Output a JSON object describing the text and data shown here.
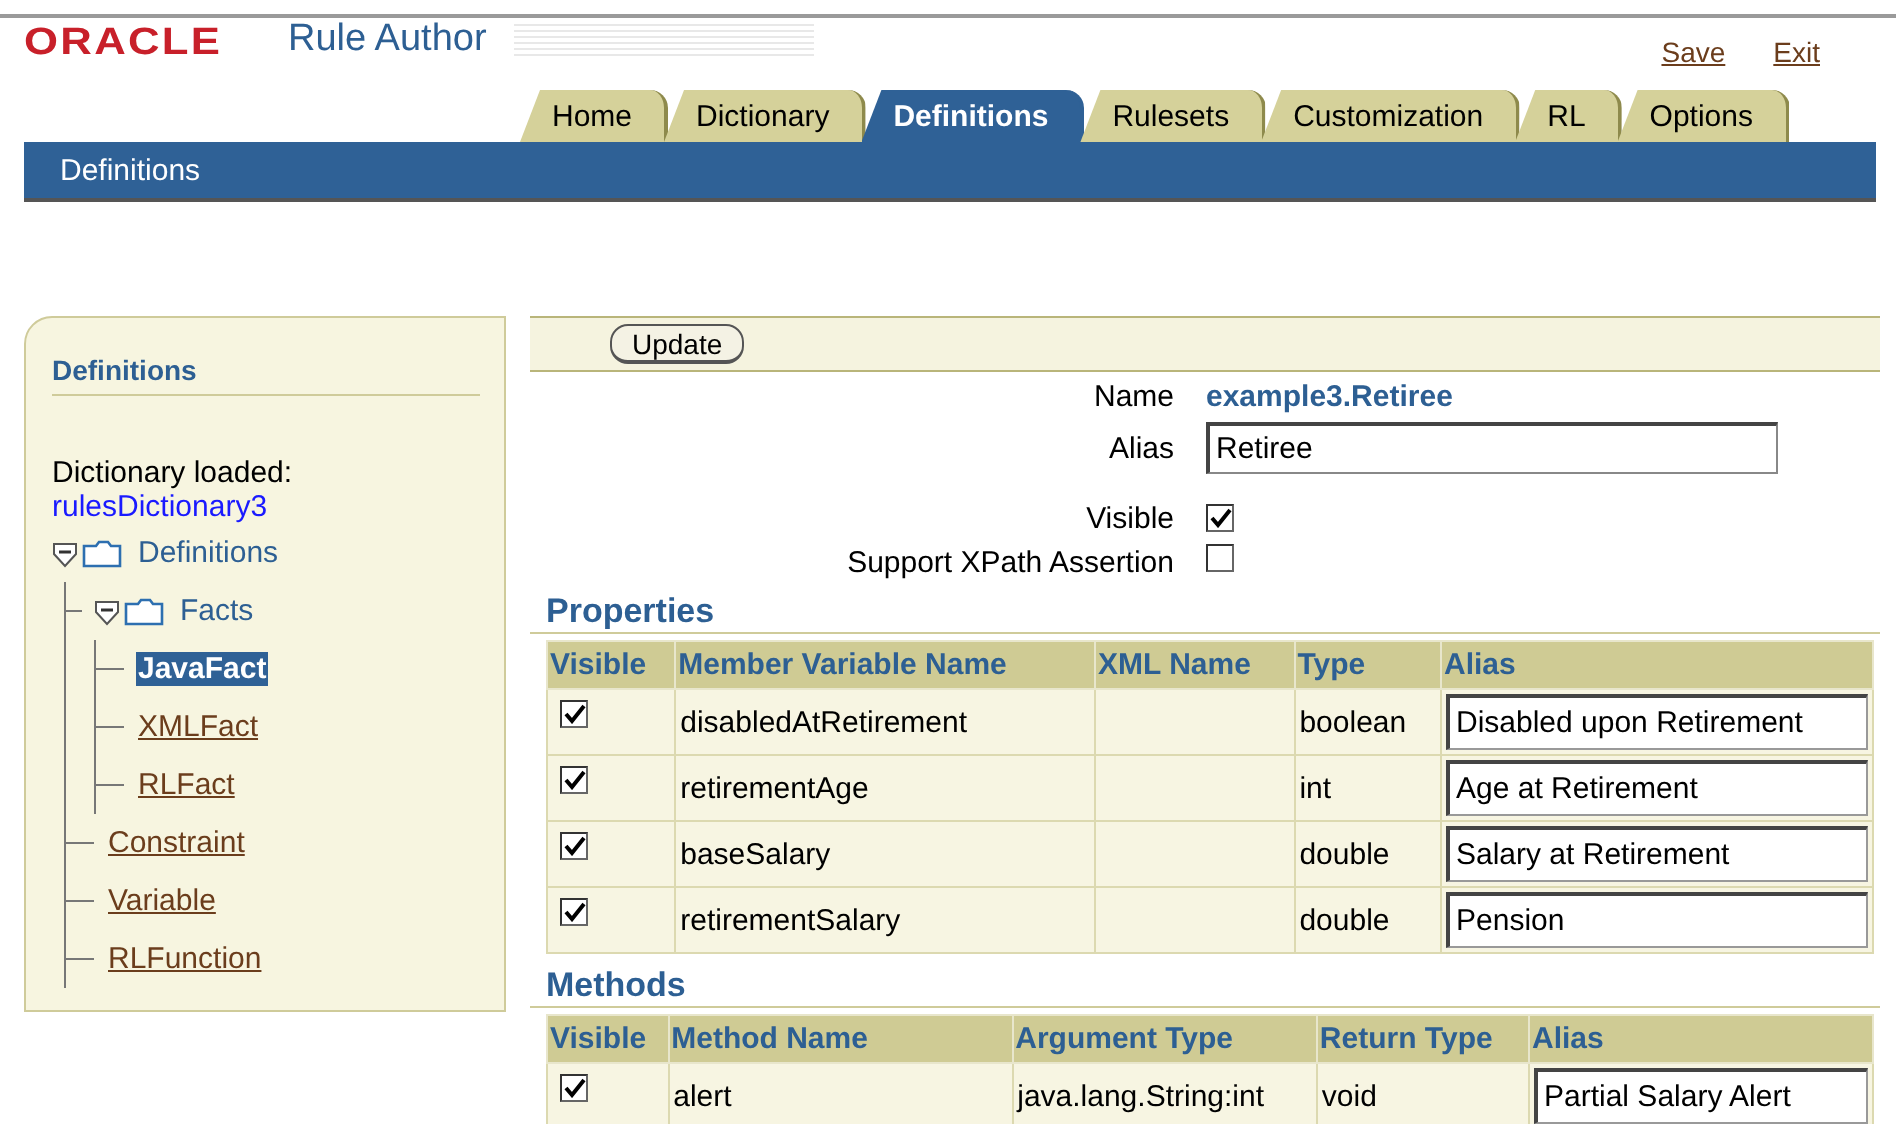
{
  "header": {
    "logo": "ORACLE",
    "app_title": "Rule Author",
    "links": [
      "Save",
      "Exit"
    ]
  },
  "tabs": [
    {
      "label": "Home",
      "selected": false
    },
    {
      "label": "Dictionary",
      "selected": false
    },
    {
      "label": "Definitions",
      "selected": true
    },
    {
      "label": "Rulesets",
      "selected": false
    },
    {
      "label": "Customization",
      "selected": false
    },
    {
      "label": "RL",
      "selected": false
    },
    {
      "label": "Options",
      "selected": false
    }
  ],
  "subheader": {
    "title": "Definitions"
  },
  "sidebar": {
    "title": "Definitions",
    "dictionary_label": "Dictionary loaded:",
    "dictionary_name": "rulesDictionary3",
    "tree": [
      {
        "label": "Definitions",
        "kind": "folder",
        "expanded": true,
        "children": [
          {
            "label": "Facts",
            "kind": "folder",
            "expanded": true,
            "children": [
              {
                "label": "JavaFact",
                "kind": "leaf",
                "selected": true
              },
              {
                "label": "XMLFact",
                "kind": "leaf",
                "selected": false
              },
              {
                "label": "RLFact",
                "kind": "leaf",
                "selected": false
              }
            ]
          },
          {
            "label": "Constraint",
            "kind": "leaf",
            "selected": false
          },
          {
            "label": "Variable",
            "kind": "leaf",
            "selected": false
          },
          {
            "label": "RLFunction",
            "kind": "leaf",
            "selected": false
          }
        ]
      }
    ]
  },
  "toolbar": {
    "button": "Update"
  },
  "form": {
    "name_label": "Name",
    "name_value": "example3.Retiree",
    "alias_label": "Alias",
    "alias_value": "Retiree",
    "visible_label": "Visible",
    "visible_checked": true,
    "xpath_label": "Support XPath Assertion",
    "xpath_checked": false
  },
  "properties": {
    "title": "Properties",
    "columns": [
      "Visible",
      "Member Variable Name",
      "XML Name",
      "Type",
      "Alias"
    ],
    "rows": [
      {
        "visible": true,
        "name": "disabledAtRetirement",
        "type": "boolean",
        "alias": "Disabled upon Retirement"
      },
      {
        "visible": true,
        "name": "retirementAge",
        "type": "int",
        "alias": "Age at Retirement"
      },
      {
        "visible": true,
        "name": "baseSalary",
        "type": "double",
        "alias": "Salary at Retirement"
      },
      {
        "visible": true,
        "name": "retirementSalary",
        "type": "double",
        "alias": "Pension"
      }
    ]
  },
  "methods": {
    "title": "Methods",
    "columns": [
      "Visible",
      "Method Name",
      "Argument Type",
      "Return Type",
      "Alias"
    ],
    "rows": [
      {
        "visible": true,
        "name": "alert",
        "argument_type": "java.lang.String:int",
        "return_type": "void",
        "alias": "Partial Salary Alert"
      }
    ]
  }
}
